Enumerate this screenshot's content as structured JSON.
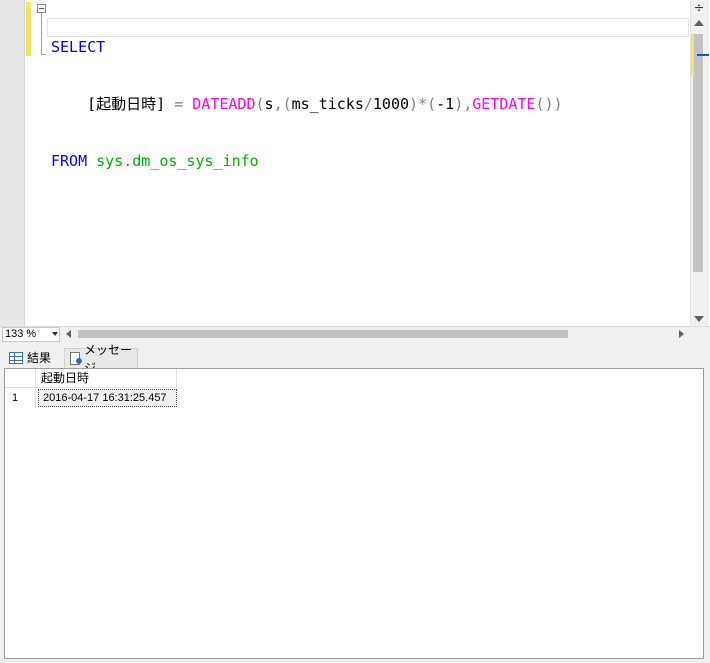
{
  "editor": {
    "line1": {
      "keyword": "SELECT"
    },
    "line2": {
      "indent": "    ",
      "alias": "[起動日時]",
      "eq": " = ",
      "fn1": "DATEADD",
      "open1": "(",
      "part": "s",
      "comma1": ",",
      "open2": "(",
      "arg": "ms_ticks",
      "div": "/",
      "num1": "1000",
      "close2": ")",
      "mul": "*",
      "open3": "(",
      "neg": "-1",
      "close3": ")",
      "comma2": ",",
      "fn2": "GETDATE",
      "parens": "()",
      "close1": ")"
    },
    "line3": {
      "keyword": "FROM",
      "object": "sys.dm_os_sys_info"
    }
  },
  "zoom": {
    "value": "133 %"
  },
  "tabs": [
    {
      "label": "結果",
      "icon": "grid-icon"
    },
    {
      "label": "メッセージ",
      "icon": "message-icon"
    }
  ],
  "results": {
    "columns": [
      "起動日時"
    ],
    "rows": [
      {
        "num": "1",
        "cells": [
          "2016-04-17 16:31:25.457"
        ]
      }
    ]
  },
  "colors": {
    "keyword": "#0000ff",
    "function": "#ff00ff",
    "system_object": "#00b000",
    "operator": "#808080",
    "change_marker": "#f5e36a"
  }
}
